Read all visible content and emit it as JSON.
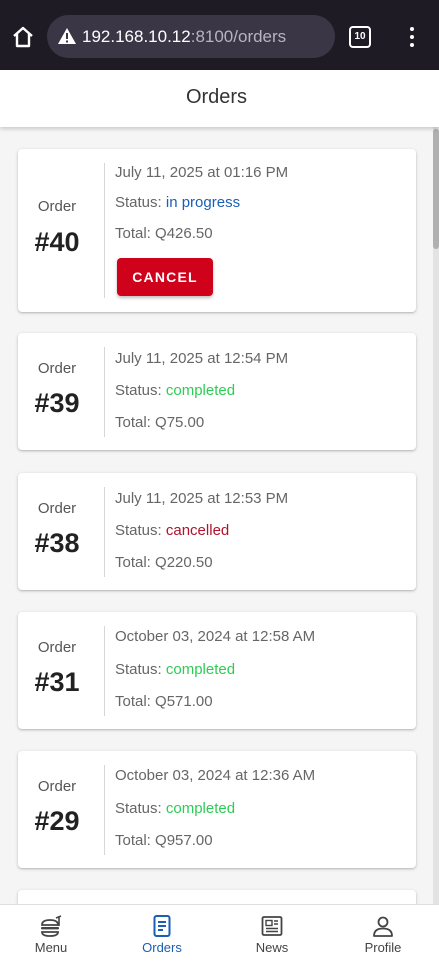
{
  "browser": {
    "url_host": "192.168.10.12",
    "url_path": ":8100/orders",
    "tab_count": "10",
    "icons": [
      "home-icon",
      "warning-icon",
      "tabs-icon",
      "more-vert-icon"
    ]
  },
  "header": {
    "title": "Orders"
  },
  "labels": {
    "order": "Order",
    "status": "Status:",
    "total": "Total:"
  },
  "colors": {
    "in_progress": "#1a5fb4",
    "completed": "#2ecc55",
    "cancelled": "#b0132b",
    "cancel_button": "#d0021b",
    "active_tab": "#1a5fb4"
  },
  "orders": [
    {
      "number": "#40",
      "date": "July 11, 2025 at 01:16 PM",
      "status": "in progress",
      "total": "Q426.50",
      "action": "CANCEL"
    },
    {
      "number": "#39",
      "date": "July 11, 2025 at 12:54 PM",
      "status": "completed",
      "total": "Q75.00"
    },
    {
      "number": "#38",
      "date": "July 11, 2025 at 12:53 PM",
      "status": "cancelled",
      "total": "Q220.50"
    },
    {
      "number": "#31",
      "date": "October 03, 2024 at 12:58 AM",
      "status": "completed",
      "total": "Q571.00"
    },
    {
      "number": "#29",
      "date": "October 03, 2024 at 12:36 AM",
      "status": "completed",
      "total": "Q957.00"
    }
  ],
  "nav": [
    {
      "label": "Menu",
      "icon": "burger-icon",
      "active": false
    },
    {
      "label": "Orders",
      "icon": "receipt-icon",
      "active": true
    },
    {
      "label": "News",
      "icon": "newspaper-icon",
      "active": false
    },
    {
      "label": "Profile",
      "icon": "person-icon",
      "active": false
    }
  ]
}
